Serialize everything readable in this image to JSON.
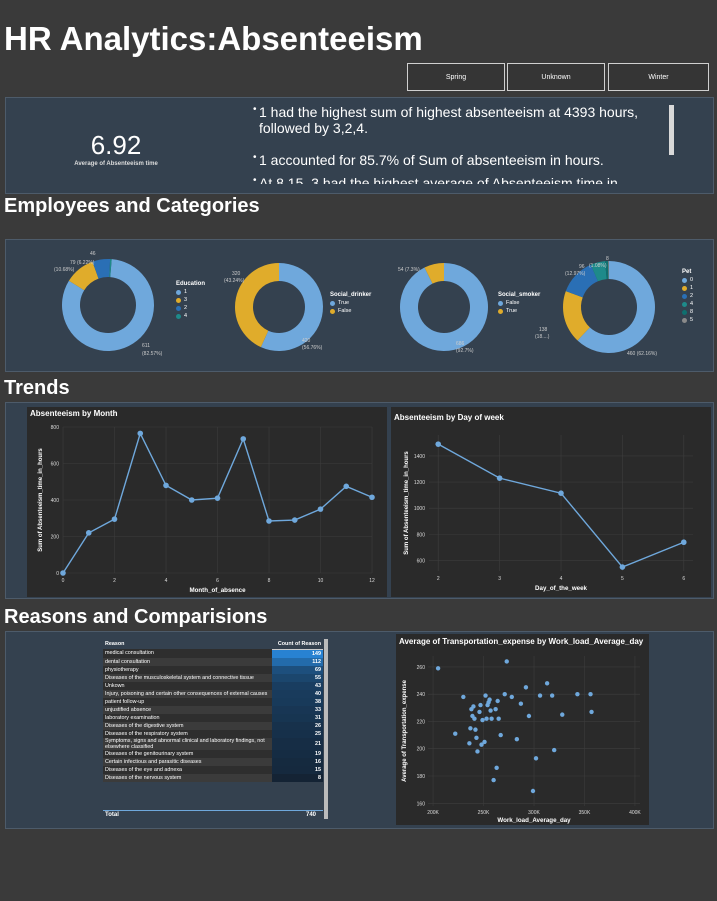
{
  "header": {
    "title": "HR Analytics:Absenteeism",
    "slicers": [
      "Spring",
      "Unknown",
      "Winter"
    ]
  },
  "kpi": {
    "value": "6.92",
    "label": "Average of Absenteeism time"
  },
  "insights": [
    "1 had the highest sum of highest absenteeism at 4393 hours, followed by 3,2,4.",
    "1 accounted for 85.7% of Sum of absenteeism in hours.",
    "At 8.15, 3 had the highest average of Absenteeism time in"
  ],
  "sections": {
    "employees": "Employees and Categories",
    "trends": "Trends",
    "reasons": "Reasons and Comparisions"
  },
  "colors": {
    "blue": "#6fa8dc",
    "gold": "#e0ac2b",
    "darkblue": "#2a6fb5",
    "teal": "#1e8a8a",
    "grey": "#8a8a8a",
    "panel": "#34414f"
  },
  "donuts": [
    {
      "legend_title": "Education",
      "legend": [
        {
          "label": "1",
          "color": "#6fa8dc"
        },
        {
          "label": "3",
          "color": "#e0ac2b"
        },
        {
          "label": "2",
          "color": "#2a6fb5"
        },
        {
          "label": "4",
          "color": "#1e8a8a"
        }
      ],
      "slices": [
        {
          "value": 611,
          "color": "#6fa8dc"
        },
        {
          "value": 79,
          "color": "#e0ac2b"
        },
        {
          "value": 46,
          "color": "#2a6fb5"
        },
        {
          "value": 4,
          "color": "#1e8a8a"
        }
      ],
      "labels": [
        {
          "line1": "611",
          "line2": "(82.57%)"
        },
        {
          "line1": "79 (6.22%)",
          "line2": "(10.68%)"
        },
        {
          "line1": "46",
          "line2": ""
        }
      ]
    },
    {
      "legend_title": "Social_drinker",
      "legend": [
        {
          "label": "True",
          "color": "#6fa8dc"
        },
        {
          "label": "False",
          "color": "#e0ac2b"
        }
      ],
      "slices": [
        {
          "value": 420,
          "color": "#6fa8dc"
        },
        {
          "value": 320,
          "color": "#e0ac2b"
        }
      ],
      "labels": [
        {
          "line1": "420",
          "line2": "(56.76%)"
        },
        {
          "line1": "320",
          "line2": "(43.24%)"
        }
      ]
    },
    {
      "legend_title": "Social_smoker",
      "legend": [
        {
          "label": "False",
          "color": "#6fa8dc"
        },
        {
          "label": "True",
          "color": "#e0ac2b"
        }
      ],
      "slices": [
        {
          "value": 686,
          "color": "#6fa8dc"
        },
        {
          "value": 54,
          "color": "#e0ac2b"
        }
      ],
      "labels": [
        {
          "line1": "686",
          "line2": "(92.7%)"
        },
        {
          "line1": "54 (7.3%)",
          "line2": ""
        }
      ]
    },
    {
      "legend_title": "Pet",
      "legend": [
        {
          "label": "0",
          "color": "#6fa8dc"
        },
        {
          "label": "1",
          "color": "#e0ac2b"
        },
        {
          "label": "2",
          "color": "#2a6fb5"
        },
        {
          "label": "4",
          "color": "#1e8a8a"
        },
        {
          "label": "8",
          "color": "#0f6f6f"
        },
        {
          "label": "5",
          "color": "#8a8a8a"
        }
      ],
      "slices": [
        {
          "value": 460,
          "color": "#6fa8dc"
        },
        {
          "value": 138,
          "color": "#e0ac2b"
        },
        {
          "value": 96,
          "color": "#2a6fb5"
        },
        {
          "value": 38,
          "color": "#1e8a8a"
        },
        {
          "value": 8,
          "color": "#0f6f6f"
        },
        {
          "value": 2,
          "color": "#8a8a8a"
        }
      ],
      "labels": [
        {
          "line1": "460 (62.16%)",
          "line2": ""
        },
        {
          "line1": "138",
          "line2": "(18....)"
        },
        {
          "line1": "96",
          "line2": "(12.97%)"
        },
        {
          "line1": "8",
          "line2": "(1.08%)"
        }
      ]
    }
  ],
  "chart_data": [
    {
      "type": "line",
      "title": "Absenteeism by Month",
      "xlabel": "Month_of_absence",
      "ylabel": "Sum of Absenteeism_time_in_hours",
      "x": [
        0,
        1,
        2,
        3,
        4,
        5,
        6,
        7,
        8,
        9,
        10,
        11,
        12
      ],
      "values": [
        0,
        220,
        295,
        765,
        480,
        400,
        410,
        735,
        285,
        290,
        350,
        475,
        415
      ],
      "xticks": [
        "0",
        "2",
        "4",
        "6",
        "8",
        "10",
        "12"
      ],
      "yticks": [
        "0",
        "200",
        "400",
        "600",
        "800"
      ],
      "xlim": [
        0,
        12
      ],
      "ylim": [
        0,
        800
      ]
    },
    {
      "type": "line",
      "title": "Absenteeism by Day of week",
      "xlabel": "Day_of_the_week",
      "ylabel": "Sum of Absenteeism_time_in_hours",
      "x": [
        2,
        3,
        4,
        5,
        6
      ],
      "values": [
        1490,
        1230,
        1115,
        550,
        740
      ],
      "xticks": [
        "2",
        "3",
        "4",
        "5",
        "6"
      ],
      "yticks": [
        "600",
        "800",
        "1000",
        "1200",
        "1400"
      ],
      "xlim": [
        1.85,
        6.15
      ],
      "ylim": [
        520,
        1560
      ]
    },
    {
      "type": "table",
      "columns": [
        "Reason",
        "Count of Reason"
      ],
      "rows": [
        [
          "medical consultation",
          "149"
        ],
        [
          "dental consultation",
          "112"
        ],
        [
          "physiotherapy",
          "69"
        ],
        [
          "Diseases of the musculoskeletal system and connective tissue",
          "55"
        ],
        [
          "Unkown",
          "43"
        ],
        [
          "Injury, poisoning and certain other consequences of external causes",
          "40"
        ],
        [
          "patient follow-up",
          "38"
        ],
        [
          "unjustified absence",
          "33"
        ],
        [
          "laboratory examination",
          "31"
        ],
        [
          "Diseases of the digestive system",
          "26"
        ],
        [
          "Diseases of the respiratory system",
          "25"
        ],
        [
          "Symptoms, signs and abnormal clinical and laboratory findings, not elsewhere classified",
          "21"
        ],
        [
          "Diseases of the genitourinary system",
          "19"
        ],
        [
          "Certain infectious and parasitic diseases",
          "16"
        ],
        [
          "Diseases of the eye and adnexa",
          "15"
        ],
        [
          "Diseases of the nervous system",
          "8"
        ]
      ],
      "total": [
        "Total",
        "740"
      ]
    },
    {
      "type": "scatter",
      "title": "Average of Transportation_expense by Work_load_Average_day",
      "xlabel": "Work_load_Average_day",
      "ylabel": "Average of Transportation_expense",
      "xticks": [
        "200K",
        "250K",
        "300K",
        "350K",
        "400K"
      ],
      "yticks": [
        "160",
        "180",
        "200",
        "220",
        "240",
        "260"
      ],
      "xlim": [
        195,
        405
      ],
      "ylim": [
        158,
        268
      ],
      "points": [
        [
          205,
          259
        ],
        [
          222,
          211
        ],
        [
          230,
          238
        ],
        [
          236,
          204
        ],
        [
          237,
          215
        ],
        [
          238,
          229
        ],
        [
          239,
          224
        ],
        [
          240,
          231
        ],
        [
          241,
          222
        ],
        [
          242,
          214
        ],
        [
          243,
          208
        ],
        [
          244,
          198
        ],
        [
          246,
          227
        ],
        [
          247,
          232
        ],
        [
          248,
          203
        ],
        [
          249,
          221
        ],
        [
          251,
          205
        ],
        [
          252,
          239
        ],
        [
          253,
          222
        ],
        [
          254,
          232
        ],
        [
          255,
          234
        ],
        [
          256,
          236
        ],
        [
          257,
          228
        ],
        [
          258,
          222
        ],
        [
          260,
          177
        ],
        [
          262,
          229
        ],
        [
          263,
          186
        ],
        [
          264,
          235
        ],
        [
          265,
          222
        ],
        [
          267,
          210
        ],
        [
          271,
          240
        ],
        [
          273,
          264
        ],
        [
          278,
          238
        ],
        [
          283,
          207
        ],
        [
          287,
          233
        ],
        [
          292,
          245
        ],
        [
          295,
          224
        ],
        [
          299,
          169
        ],
        [
          302,
          193
        ],
        [
          306,
          239
        ],
        [
          313,
          248
        ],
        [
          318,
          239
        ],
        [
          320,
          199
        ],
        [
          328,
          225
        ],
        [
          343,
          240
        ],
        [
          356,
          240
        ],
        [
          357,
          227
        ]
      ]
    }
  ]
}
